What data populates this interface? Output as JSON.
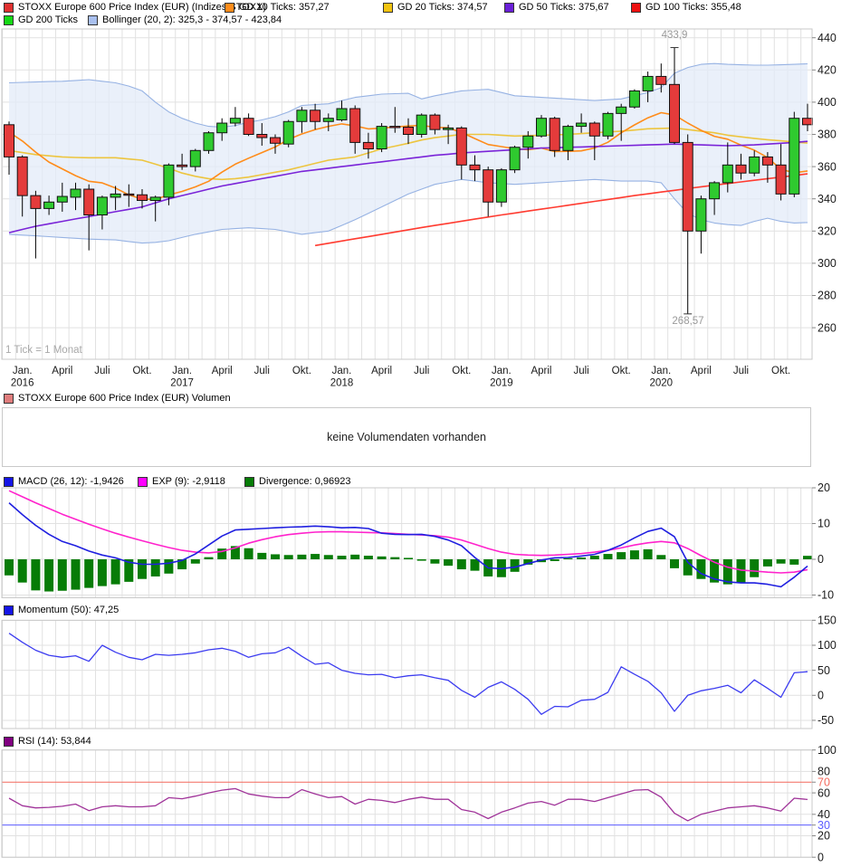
{
  "title": "STOXX Europe 600 Price Index (EUR) (Indizes STOXX)",
  "legends": {
    "price_row1": [
      {
        "label": "STOXX Europe 600 Price Index (EUR) (Indizes STOXX)",
        "color": "#e03131"
      },
      {
        "label": "GD 10 Ticks: 357,27",
        "color": "#ff8c1a"
      },
      {
        "label": "GD 20 Ticks: 374,57",
        "color": "#f2c411"
      },
      {
        "label": "GD 50 Ticks: 375,67",
        "color": "#6a1fd8"
      },
      {
        "label": "GD 100 Ticks: 355,48",
        "color": "#ee1111"
      }
    ],
    "price_row2": [
      {
        "label": "GD 200 Ticks",
        "color": "#16d816"
      },
      {
        "label": "Bollinger (20, 2): 325,3 - 374,57 - 423,84",
        "color": "#a9c0ef"
      }
    ],
    "volume": [
      {
        "label": "STOXX Europe 600 Price Index (EUR) Volumen",
        "color": "#e07d7d"
      }
    ],
    "macd": [
      {
        "label": "MACD (26, 12): -1,9426",
        "color": "#1414e6"
      },
      {
        "label": "EXP (9): -2,9118",
        "color": "#ff00ff"
      },
      {
        "label": "Divergence: 0,96923",
        "color": "#077c07"
      }
    ],
    "momentum": [
      {
        "label": "Momentum (50): 47,25",
        "color": "#1414e6"
      }
    ],
    "rsi": [
      {
        "label": "RSI (14): 53,844",
        "color": "#800080"
      }
    ]
  },
  "volume": {
    "message": "keine Volumendaten vorhanden"
  },
  "main": {
    "tick_note": "1 Tick = 1 Monat",
    "annotation_high": "433,9",
    "annotation_low": "268,57"
  },
  "colors": {
    "candle_up": "#2fca2f",
    "candle_down": "#e43b3b",
    "candle_stroke": "#111111",
    "gd10": "#ff8c1a",
    "gd20": "#edc53f",
    "gd50": "#7a24d8",
    "gd100": "#ff3b30",
    "boll_line": "#96b2e3",
    "boll_fill": "#e3ebf8",
    "macd_line": "#1f1fe0",
    "exp_line": "#ff22cc",
    "divergence_bar": "#077c07",
    "momentum_line": "#3c3cf0",
    "rsi_line": "#a03399",
    "rsi_70_line": "#f4695c",
    "rsi_30_line": "#5c5cff",
    "grid": "#e1e1e1",
    "border": "#c9c9c9",
    "tick_text": "#1a1a1a",
    "annotation": "#9a9a9a"
  },
  "chart_data": {
    "type": "candlestick",
    "x_unit_note": "1 Tick = 1 Monat",
    "months": 61,
    "x_axis": {
      "labels": [
        {
          "m": 1,
          "text": "Jan.",
          "year": "2016"
        },
        {
          "m": 4,
          "text": "April",
          "year": ""
        },
        {
          "m": 7,
          "text": "Juli",
          "year": ""
        },
        {
          "m": 10,
          "text": "Okt.",
          "year": ""
        },
        {
          "m": 13,
          "text": "Jan.",
          "year": "2017"
        },
        {
          "m": 16,
          "text": "April",
          "year": ""
        },
        {
          "m": 19,
          "text": "Juli",
          "year": ""
        },
        {
          "m": 22,
          "text": "Okt.",
          "year": ""
        },
        {
          "m": 25,
          "text": "Jan.",
          "year": "2018"
        },
        {
          "m": 28,
          "text": "April",
          "year": ""
        },
        {
          "m": 31,
          "text": "Juli",
          "year": ""
        },
        {
          "m": 34,
          "text": "Okt.",
          "year": ""
        },
        {
          "m": 37,
          "text": "Jan.",
          "year": "2019"
        },
        {
          "m": 40,
          "text": "April",
          "year": ""
        },
        {
          "m": 43,
          "text": "Juli",
          "year": ""
        },
        {
          "m": 46,
          "text": "Okt.",
          "year": ""
        },
        {
          "m": 49,
          "text": "Jan.",
          "year": "2020"
        },
        {
          "m": 52,
          "text": "April",
          "year": ""
        },
        {
          "m": 55,
          "text": "Juli",
          "year": ""
        },
        {
          "m": 58,
          "text": "Okt.",
          "year": ""
        }
      ]
    },
    "price_panel": {
      "ylim": [
        240,
        445
      ],
      "y_ticks": [
        440,
        420,
        400,
        380,
        360,
        340,
        320,
        300,
        280,
        260
      ],
      "annotated_high": {
        "m": 50,
        "value": 433.9,
        "label": "433,9"
      },
      "annotated_low": {
        "m": 51,
        "value": 268.57,
        "label": "268,57"
      },
      "candles_ohlc": [
        [
          386,
          388,
          355,
          366
        ],
        [
          366,
          367,
          329,
          342
        ],
        [
          342,
          345,
          303,
          334
        ],
        [
          334,
          342,
          330,
          338
        ],
        [
          338,
          350,
          332,
          341.5
        ],
        [
          341,
          350,
          333,
          346
        ],
        [
          346,
          349,
          308,
          330
        ],
        [
          330,
          342,
          321,
          341
        ],
        [
          341,
          348,
          333,
          343
        ],
        [
          343,
          349,
          335,
          342.5
        ],
        [
          342.5,
          346,
          334,
          339
        ],
        [
          339,
          342,
          326,
          341
        ],
        [
          341,
          362,
          336,
          361
        ],
        [
          361,
          368,
          358,
          360
        ],
        [
          360,
          371,
          357,
          370
        ],
        [
          370,
          382,
          368,
          381
        ],
        [
          381,
          390,
          376,
          387
        ],
        [
          387,
          397,
          385,
          390
        ],
        [
          390,
          393,
          379,
          380
        ],
        [
          380,
          387,
          373,
          378
        ],
        [
          378,
          380,
          368,
          374.5
        ],
        [
          374,
          389,
          372,
          388
        ],
        [
          388,
          397,
          381,
          395
        ],
        [
          395,
          399,
          383,
          388
        ],
        [
          388,
          393,
          382,
          390
        ],
        [
          389,
          401,
          388,
          396
        ],
        [
          396,
          398,
          368,
          375
        ],
        [
          375,
          381,
          365,
          371
        ],
        [
          371,
          387,
          369,
          385
        ],
        [
          385,
          397,
          381,
          384.5
        ],
        [
          384.5,
          390,
          374,
          380
        ],
        [
          380,
          393,
          378,
          392
        ],
        [
          392,
          393,
          380,
          383
        ],
        [
          383,
          386,
          374,
          384
        ],
        [
          384,
          385,
          352,
          361
        ],
        [
          361,
          367,
          351,
          358
        ],
        [
          358,
          360,
          329,
          338
        ],
        [
          338,
          359,
          335,
          358
        ],
        [
          358,
          373,
          356,
          372
        ],
        [
          372,
          382,
          365,
          379
        ],
        [
          379,
          392,
          378,
          390
        ],
        [
          390,
          391,
          366,
          370
        ],
        [
          370,
          386,
          364,
          385
        ],
        [
          385,
          393,
          381,
          387
        ],
        [
          387,
          388,
          364,
          379
        ],
        [
          379,
          394,
          377,
          393
        ],
        [
          393,
          399,
          376,
          397
        ],
        [
          397,
          408,
          396,
          407
        ],
        [
          407,
          419,
          400,
          416
        ],
        [
          416,
          424,
          406,
          411
        ],
        [
          411,
          433.9,
          374,
          375
        ],
        [
          375,
          380,
          268.57,
          320
        ],
        [
          320,
          342,
          306,
          340
        ],
        [
          340,
          351,
          330,
          350
        ],
        [
          350,
          375,
          344,
          361
        ],
        [
          361,
          368,
          352,
          356
        ],
        [
          356,
          370,
          354,
          366
        ],
        [
          366,
          369,
          350,
          361
        ],
        [
          361,
          374,
          339,
          343
        ],
        [
          343,
          394,
          341,
          390
        ],
        [
          390,
          399,
          382,
          386
        ]
      ],
      "gd10": [
        381.4,
        375.9,
        369,
        362.8,
        358.6,
        354.4,
        350.9,
        349.9,
        346.7,
        342.5,
        339.8,
        339.7,
        342.4,
        344.6,
        347.4,
        350.9,
        356.6,
        361.5,
        365.2,
        368.7,
        372.2,
        376.9,
        380.3,
        383,
        385,
        386.5,
        385.3,
        383.4,
        383.9,
        384.6,
        385.2,
        385.6,
        384.4,
        384.1,
        381.2,
        377.4,
        373.7,
        372.4,
        371.1,
        370.5,
        371.5,
        369.3,
        369.5,
        369.8,
        371.6,
        375.1,
        381,
        385.9,
        390.3,
        393.5,
        392,
        387,
        382.5,
        378.8,
        377,
        373.3,
        370.2,
        365.6,
        358.3,
        356.2,
        357.3
      ],
      "gd20": [
        370,
        368.7,
        367.5,
        366.7,
        366,
        365.7,
        365.5,
        365.5,
        365.5,
        364.7,
        364,
        361.5,
        359,
        356,
        354,
        352.5,
        352,
        352.5,
        353.5,
        355,
        356.5,
        358,
        360,
        362,
        364,
        365,
        366,
        368.5,
        371,
        372.7,
        374.5,
        376.5,
        378,
        379,
        380,
        380,
        380,
        379.5,
        379,
        379.2,
        379.5,
        379.7,
        380,
        380.5,
        381,
        381.5,
        382,
        382.7,
        383.5,
        383.7,
        384,
        383,
        382,
        381,
        379.5,
        378.5,
        377.5,
        376.7,
        376,
        375.3,
        374.6
      ],
      "gd50": [
        319,
        321,
        323,
        324.5,
        326,
        327.5,
        329,
        330.5,
        332,
        333.5,
        335,
        337.5,
        340,
        342,
        344,
        346,
        348,
        349.5,
        351,
        352.5,
        354,
        355.5,
        357,
        358,
        359,
        360,
        361,
        362,
        363,
        364,
        365,
        366,
        367,
        367.7,
        368.5,
        369,
        369.5,
        370,
        370.5,
        371,
        371.5,
        371.7,
        372,
        372.2,
        372.5,
        372.7,
        373,
        373.2,
        373.5,
        373.7,
        374,
        373.7,
        373.5,
        373.2,
        373,
        373.2,
        373.5,
        374,
        374.5,
        375,
        375.7
      ],
      "gd100": {
        "start": 23,
        "values": [
          311,
          312.4,
          313.8,
          315.2,
          316.6,
          318,
          319.4,
          320.8,
          322.2,
          323.5,
          324.8,
          326.1,
          327.4,
          328.7,
          330,
          331.2,
          332.4,
          333.6,
          334.8,
          336,
          337.2,
          338.4,
          339.6,
          340.8,
          342,
          343.1,
          344.2,
          345.3,
          346.4,
          347.5,
          348.5,
          349.5,
          350.5,
          351.5,
          352.5,
          353.5,
          354.5,
          355.5
        ]
      },
      "boll_upper": [
        412,
        412.3,
        412.5,
        412.8,
        413,
        413.5,
        414,
        413,
        412,
        410,
        407,
        400,
        394,
        390,
        387,
        385,
        384.5,
        385.5,
        387.5,
        389,
        391,
        394,
        398,
        398.5,
        399,
        401,
        403,
        404,
        405,
        405.3,
        405.5,
        402,
        404,
        405.5,
        407,
        407.5,
        408,
        406,
        404,
        403.5,
        403,
        402.5,
        402,
        401.5,
        401,
        401.5,
        402,
        404,
        406,
        409,
        418,
        421.5,
        423.5,
        424,
        423.5,
        423.2,
        423,
        423,
        423.2,
        423.5,
        423.8
      ],
      "boll_lower": [
        318,
        317.5,
        317,
        316.5,
        316,
        315.5,
        315,
        314.7,
        314.5,
        313.5,
        312.5,
        313,
        314,
        316,
        318,
        319.5,
        321,
        321.5,
        322,
        321.5,
        321,
        319.5,
        318,
        319,
        320,
        323.5,
        327,
        331,
        335,
        339,
        343,
        346,
        349,
        350.5,
        352,
        351,
        350,
        349.5,
        349,
        349.5,
        350,
        350.5,
        351,
        351.5,
        352,
        351.5,
        351,
        351,
        351,
        350,
        340,
        331,
        327,
        325,
        324,
        323.5,
        326,
        328,
        326,
        325,
        325.3
      ]
    },
    "macd_panel": {
      "ylim": [
        -10.8,
        20
      ],
      "y_ticks": [
        20,
        10,
        0,
        -10
      ],
      "macd_line": [
        15.8,
        12.5,
        9.5,
        7,
        5,
        3.8,
        2.3,
        1.2,
        0.4,
        -0.8,
        -1.4,
        -1.4,
        -1.1,
        -0.3,
        1.5,
        4,
        6.5,
        8.2,
        8.4,
        8.6,
        8.8,
        9,
        9.1,
        9.3,
        9.1,
        8.8,
        8.9,
        8.6,
        7.3,
        7,
        6.9,
        7,
        6.4,
        5.4,
        3.8,
        0.5,
        -2.4,
        -2.6,
        -2.2,
        -1.2,
        -0.2,
        0.4,
        0.5,
        0.9,
        1.4,
        2.5,
        4,
        6,
        7.8,
        8.7,
        6.3,
        -0.8,
        -4,
        -5.5,
        -6.3,
        -6.6,
        -6.6,
        -7,
        -7.7,
        -5,
        -1.9
      ],
      "exp_line": [
        19.2,
        17.5,
        15.8,
        14.2,
        12.6,
        11.2,
        9.8,
        8.5,
        7.3,
        6.2,
        5.2,
        4.2,
        3.3,
        2.5,
        2,
        1.8,
        2.2,
        3.2,
        4.5,
        5.5,
        6.3,
        6.9,
        7.3,
        7.6,
        7.7,
        7.7,
        7.6,
        7.5,
        7.4,
        7.2,
        7,
        6.8,
        6.6,
        6.2,
        5.4,
        4.2,
        3,
        2,
        1.4,
        1.2,
        1.1,
        1.2,
        1.4,
        1.6,
        2,
        2.5,
        3.2,
        4,
        4.6,
        5,
        4.6,
        3,
        1,
        -0.8,
        -2.2,
        -3,
        -3.3,
        -3.6,
        -3.8,
        -3.6,
        -2.9
      ],
      "divergence": [
        -4.5,
        -6.5,
        -8.7,
        -9,
        -8.8,
        -8.5,
        -8,
        -7.5,
        -7,
        -6.3,
        -5.5,
        -4.8,
        -4,
        -2.8,
        -1.2,
        0.6,
        3,
        3.7,
        3.1,
        1.8,
        1.4,
        1.2,
        1.3,
        1.5,
        1.2,
        1,
        1.3,
        1,
        0.8,
        0.6,
        0.4,
        -0.4,
        -1.2,
        -1.8,
        -2.8,
        -3.2,
        -4.8,
        -5,
        -3.5,
        -1.5,
        -0.8,
        -0.5,
        0.3,
        0.5,
        1,
        1.5,
        2,
        2.5,
        2.8,
        1.2,
        -2.5,
        -4.5,
        -5.5,
        -6.5,
        -7,
        -6.5,
        -5,
        -2,
        -1.2,
        -1.5,
        0.97
      ]
    },
    "momentum_panel": {
      "ylim": [
        -66,
        150
      ],
      "y_ticks": [
        150,
        100,
        50,
        0,
        -50
      ],
      "values": [
        124,
        106,
        90,
        80,
        76,
        79,
        68,
        100,
        86,
        76,
        71,
        82,
        80,
        82,
        85,
        91,
        94,
        88,
        76,
        83,
        85,
        96,
        78,
        62,
        65,
        50,
        44,
        41,
        42,
        35,
        39,
        41,
        35,
        30,
        10,
        -4,
        16,
        27,
        12,
        -8,
        -38,
        -22,
        -23,
        -10,
        -8,
        6,
        57,
        42,
        28,
        5,
        -32,
        0,
        9,
        14,
        20,
        5,
        31,
        14,
        -4,
        45,
        47.25
      ]
    },
    "rsi_panel": {
      "ylim": [
        0,
        100
      ],
      "y_ticks": [
        100,
        80,
        70,
        60,
        40,
        30,
        20,
        0
      ],
      "grid_ticks": [
        100,
        80,
        60,
        40,
        20,
        0
      ],
      "overbought": 70,
      "oversold": 30,
      "values": [
        55,
        48,
        46,
        46.5,
        47.5,
        49.5,
        43.5,
        47,
        48,
        47,
        47,
        48,
        55.5,
        54.5,
        57,
        60,
        62.5,
        64,
        59,
        57,
        55.5,
        55.5,
        63,
        59,
        55.5,
        56.5,
        49.5,
        54,
        53,
        51,
        54,
        56,
        54,
        54,
        44.5,
        42,
        36,
        42,
        46,
        50.5,
        52,
        48.5,
        54,
        54,
        52,
        55.5,
        59,
        62.5,
        63,
        56,
        41,
        34,
        40,
        43,
        46,
        47,
        48,
        46,
        43,
        55,
        53.844
      ]
    }
  }
}
